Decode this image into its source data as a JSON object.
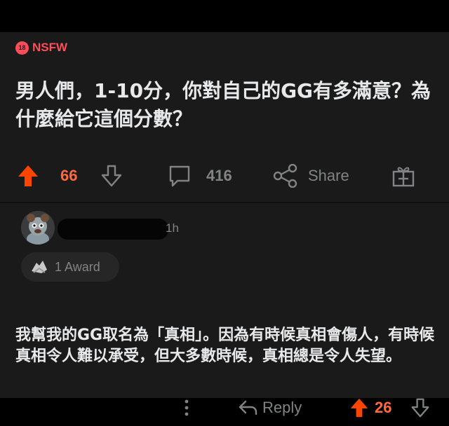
{
  "post": {
    "nsfw_badge": "18",
    "nsfw_label": "NSFW",
    "title": "男人們，1-10分，你對自己的GG有多滿意？為什麼給它這個分數？",
    "upvotes": "66",
    "comments": "416",
    "share_label": "Share"
  },
  "comment": {
    "time": "1h",
    "award_label": "1 Award",
    "body": "我幫我的GG取名為「真相」。因為有時候真相會傷人，有時候真相令人難以承受，但大多數時候，真相總是令人失望。",
    "reply_label": "Reply",
    "upvotes": "26"
  },
  "colors": {
    "accent": "#ff6a3d",
    "nsfw": "#ff4d5a",
    "background": "#1a1a1b"
  },
  "icons": [
    "upvote-arrow-icon",
    "downvote-arrow-icon",
    "comment-bubble-icon",
    "share-icon",
    "gift-award-icon",
    "reply-arrow-icon",
    "more-options-icon",
    "award-icon"
  ]
}
